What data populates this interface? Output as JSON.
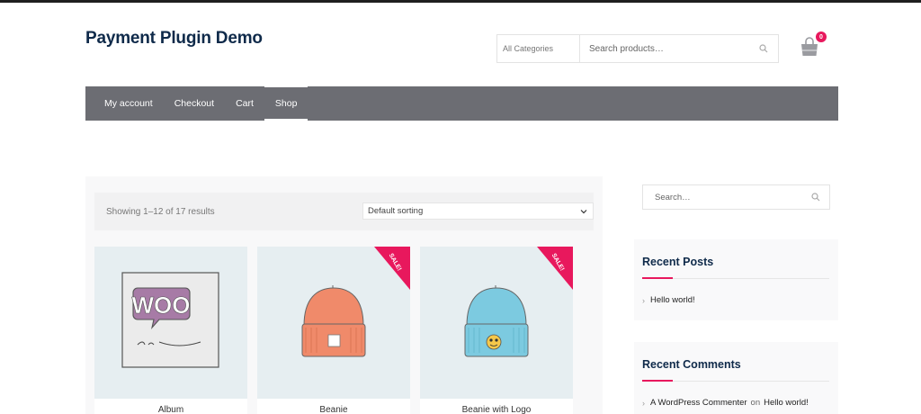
{
  "site": {
    "title": "Payment Plugin Demo"
  },
  "header_search": {
    "category": "All Categories",
    "placeholder": "Search products…"
  },
  "cart": {
    "count": "0"
  },
  "nav": {
    "items": [
      {
        "label": "My account"
      },
      {
        "label": "Checkout"
      },
      {
        "label": "Cart"
      },
      {
        "label": "Shop",
        "active": true
      }
    ]
  },
  "shop": {
    "result_count": "Showing 1–12 of 17 results",
    "sorting": "Default sorting",
    "products": [
      {
        "title": "Album",
        "sale": false,
        "image": "woo-album-illustration"
      },
      {
        "title": "Beanie",
        "sale": true,
        "image": "orange-beanie-illustration"
      },
      {
        "title": "Beanie with Logo",
        "sale": true,
        "image": "blue-beanie-logo-illustration"
      }
    ],
    "sale_label": "SALE!"
  },
  "sidebar": {
    "search_placeholder": "Search…",
    "recent_posts": {
      "title": "Recent Posts",
      "items": [
        "Hello world!"
      ]
    },
    "recent_comments": {
      "title": "Recent Comments",
      "author": "A WordPress Commenter",
      "connector": "on",
      "post": "Hello world!"
    }
  },
  "colors": {
    "accent": "#e8185d",
    "nav_bg": "#6c6d73",
    "title": "#0f2a4a"
  }
}
